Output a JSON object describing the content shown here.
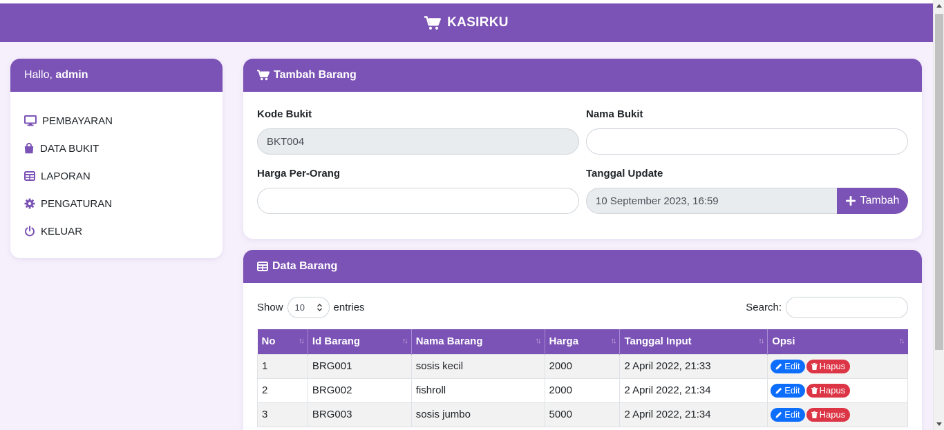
{
  "app": {
    "title": "KASIRKU"
  },
  "sidebar": {
    "greeting": "Hallo,",
    "user": "admin",
    "items": [
      {
        "label": "PEMBAYARAN",
        "icon": "monitor-icon"
      },
      {
        "label": "DATA BUKIT",
        "icon": "bag-icon"
      },
      {
        "label": "LAPORAN",
        "icon": "table-icon"
      },
      {
        "label": "PENGATURAN",
        "icon": "gear-icon"
      },
      {
        "label": "KELUAR",
        "icon": "power-icon"
      }
    ]
  },
  "form": {
    "title": "Tambah Barang",
    "kode_label": "Kode Bukit",
    "kode_value": "BKT004",
    "nama_label": "Nama Bukit",
    "nama_value": "",
    "harga_label": "Harga Per-Orang",
    "harga_value": "",
    "tanggal_label": "Tanggal Update",
    "tanggal_value": "10 September 2023, 16:59",
    "submit_label": "Tambah"
  },
  "data_table": {
    "title": "Data Barang",
    "show_label": "Show",
    "entries_label": "entries",
    "page_length": "10",
    "search_label": "Search:",
    "columns": [
      "No",
      "Id Barang",
      "Nama Barang",
      "Harga",
      "Tanggal Input",
      "Opsi"
    ],
    "rows": [
      {
        "no": "1",
        "id": "BRG001",
        "nama": "sosis kecil",
        "harga": "2000",
        "tanggal": "2 April 2022, 21:33"
      },
      {
        "no": "2",
        "id": "BRG002",
        "nama": "fishroll",
        "harga": "2000",
        "tanggal": "2 April 2022, 21:34"
      },
      {
        "no": "3",
        "id": "BRG003",
        "nama": "sosis jumbo",
        "harga": "5000",
        "tanggal": "2 April 2022, 21:34"
      }
    ],
    "edit_label": "Edit",
    "hapus_label": "Hapus"
  },
  "colors": {
    "primary": "#7b52b5",
    "background": "#f6f0fc",
    "edit": "#0d6efd",
    "delete": "#dc3545"
  }
}
